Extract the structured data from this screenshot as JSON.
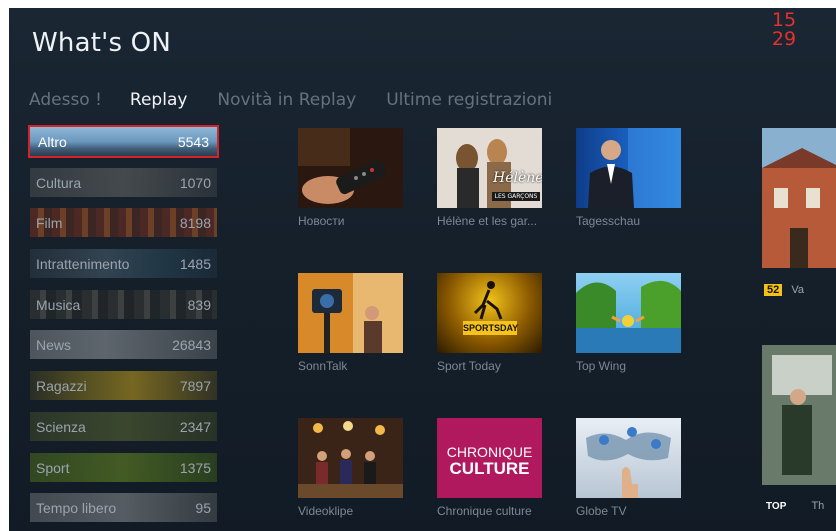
{
  "header": {
    "title": "What's ON",
    "clock_hours": "15",
    "clock_minutes": "29"
  },
  "tabs": [
    {
      "label": "Adesso !"
    },
    {
      "label": "Replay",
      "active": true
    },
    {
      "label": "Novità in Replay"
    },
    {
      "label": "Ultime registrazioni"
    }
  ],
  "categories": [
    {
      "label": "Altro",
      "count": "5543",
      "selected": true
    },
    {
      "label": "Cultura",
      "count": "1070"
    },
    {
      "label": "Film",
      "count": "8198"
    },
    {
      "label": "Intrattenimento",
      "count": "1485"
    },
    {
      "label": "Musica",
      "count": "839"
    },
    {
      "label": "News",
      "count": "26843"
    },
    {
      "label": "Ragazzi",
      "count": "7897"
    },
    {
      "label": "Scienza",
      "count": "2347"
    },
    {
      "label": "Sport",
      "count": "1375"
    },
    {
      "label": "Tempo libero",
      "count": "95"
    }
  ],
  "programs": [
    {
      "title": "Новости"
    },
    {
      "title": "Hélène et les gar..."
    },
    {
      "title": "Tagesschau"
    },
    {
      "title": "SonnTalk"
    },
    {
      "title": "Sport Today"
    },
    {
      "title": "Top Wing"
    },
    {
      "title": "Videoklipe"
    },
    {
      "title": "Chronique culture"
    },
    {
      "title": "Globe TV"
    }
  ],
  "thumb_text": {
    "helene_logo": "Hélène",
    "helene_sub": "LES GARÇONS",
    "sportsday": "SPORTSDAY",
    "chronique_1": "CHRONIQUE",
    "chronique_2": "CULTURE"
  },
  "side_items": [
    {
      "channel_badge": "52",
      "suffix": "Va"
    },
    {
      "channel_badge": "TOP",
      "suffix": "Th"
    }
  ],
  "colors": {
    "accent": "#d2242b",
    "background": "#16212c",
    "chronique_bg": "#b0195e"
  }
}
